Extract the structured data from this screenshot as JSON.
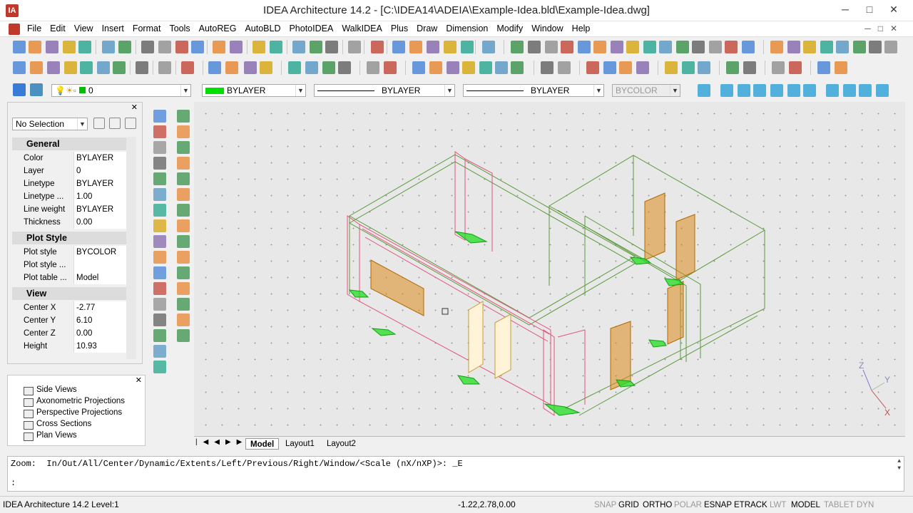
{
  "window": {
    "title": "IDEA Architecture 14.2  - [C:\\IDEA14\\ADEIA\\Example-Idea.bld\\Example-Idea.dwg]",
    "logo": "IA",
    "min": "─",
    "max": "□",
    "close": "✕"
  },
  "menu": [
    "File",
    "Edit",
    "View",
    "Insert",
    "Format",
    "Tools",
    "AutoREG",
    "AutoBLD",
    "PhotoIDEA",
    "WalkIDEA",
    "Plus",
    "Draw",
    "Dimension",
    "Modify",
    "Window",
    "Help"
  ],
  "layer_toolbar": {
    "layer_value": "0",
    "color_value": "BYLAYER",
    "linetype_value": "BYLAYER",
    "lineweight_value": "BYLAYER",
    "plotstyle_value": "BYCOLOR"
  },
  "properties": {
    "selection": "No Selection",
    "groups": [
      {
        "title": "General",
        "rows": [
          [
            "Color",
            "BYLAYER"
          ],
          [
            "Layer",
            "0"
          ],
          [
            "Linetype",
            "BYLAYER"
          ],
          [
            "Linetype ...",
            "1.00"
          ],
          [
            "Line weight",
            "BYLAYER"
          ],
          [
            "Thickness",
            "0.00"
          ]
        ]
      },
      {
        "title": "Plot Style",
        "rows": [
          [
            "Plot style",
            "BYCOLOR"
          ],
          [
            "Plot style ...",
            ""
          ],
          [
            "Plot table ...",
            "Model"
          ]
        ]
      },
      {
        "title": "View",
        "rows": [
          [
            "Center X",
            "-2.77"
          ],
          [
            "Center Y",
            "6.10"
          ],
          [
            "Center Z",
            "0.00"
          ],
          [
            "Height",
            "10.93"
          ]
        ]
      }
    ]
  },
  "tree": [
    "Side Views",
    "Axonometric Projections",
    "Perspective Projections",
    "Cross Sections",
    "Plan Views"
  ],
  "tabs": [
    "Model",
    "Layout1",
    "Layout2"
  ],
  "command": {
    "line1": "Zoom:  In/Out/All/Center/Dynamic/Extents/Left/Previous/Right/Window/<Scale (nX/nXP)>: _E",
    "line2": ":"
  },
  "status": {
    "left": "IDEA Architecture 14.2 Level:1",
    "coords": "-1.22,2.78,0.00",
    "buttons": [
      "SNAP",
      "GRID",
      "ORTHO",
      "POLAR",
      "ESNAP",
      "ETRACK",
      "LWT",
      "MODEL",
      "TABLET",
      "DYN"
    ],
    "active": [
      "GRID",
      "ORTHO",
      "ESNAP",
      "ETRACK",
      "MODEL"
    ]
  },
  "ucs": {
    "x": "X",
    "y": "Y",
    "z": "Z"
  },
  "colors": {
    "wall_green": "#5a9a3c",
    "wall_pink": "#e0557a",
    "door_orange": "#d98a1a",
    "floor_green": "#22dd22"
  }
}
